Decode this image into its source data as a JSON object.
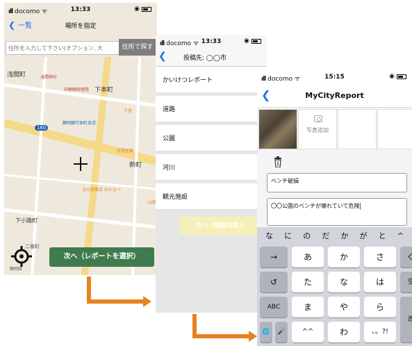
{
  "screen1": {
    "status": {
      "carrier": "docomo",
      "time": "13:33"
    },
    "nav": {
      "back_label": "一覧",
      "title": "場所を指定"
    },
    "search": {
      "placeholder": "住所を入力して下さい(オプション, 大",
      "button_label": "住所で探す"
    },
    "map_labels": [
      "浅間町",
      "浅間神社",
      "中野眼科医院",
      "下本町",
      "静岡銀行本町支店",
      "千金",
      "160",
      "花見医療",
      "新町",
      "北の保育店 わたなべ",
      "山田",
      "下小路町",
      "静岡県",
      "二番町"
    ],
    "next_label": "次へ（レポートを選択）"
  },
  "screen2": {
    "status": {
      "carrier": "docomo",
      "time": "13:33"
    },
    "nav": {
      "title": "投稿先: ◯◯市"
    },
    "categories": [
      "かいけつレポート",
      "道路",
      "公園",
      "河川",
      "観光施設"
    ],
    "next_label": "次へ (投稿内容入"
  },
  "screen3": {
    "status": {
      "carrier": "docomo",
      "time": "15:15"
    },
    "nav": {
      "title": "MyCityReport"
    },
    "add_photo_label": "写真追加",
    "title_value": "ベンチ破損",
    "description_value": "〇〇公園のベンチが壊れていて危険",
    "keyboard": {
      "predictions": [
        "な",
        "に",
        "の",
        "だ",
        "か",
        "が",
        "と",
        "^"
      ],
      "row1": [
        "→",
        "あ",
        "か",
        "さ",
        "⌫"
      ],
      "row2": [
        "↺",
        "た",
        "な",
        "は",
        "空白"
      ],
      "row3": [
        "ABC",
        "ま",
        "や",
        "ら",
        "改行"
      ],
      "row4": [
        "🌐",
        "🎤",
        "^^",
        "わ",
        "、。?!"
      ]
    }
  },
  "colors": {
    "accent_blue": "#1a6fe0",
    "next_green": "#3f7b4f",
    "arrow_orange": "#e8821e"
  }
}
